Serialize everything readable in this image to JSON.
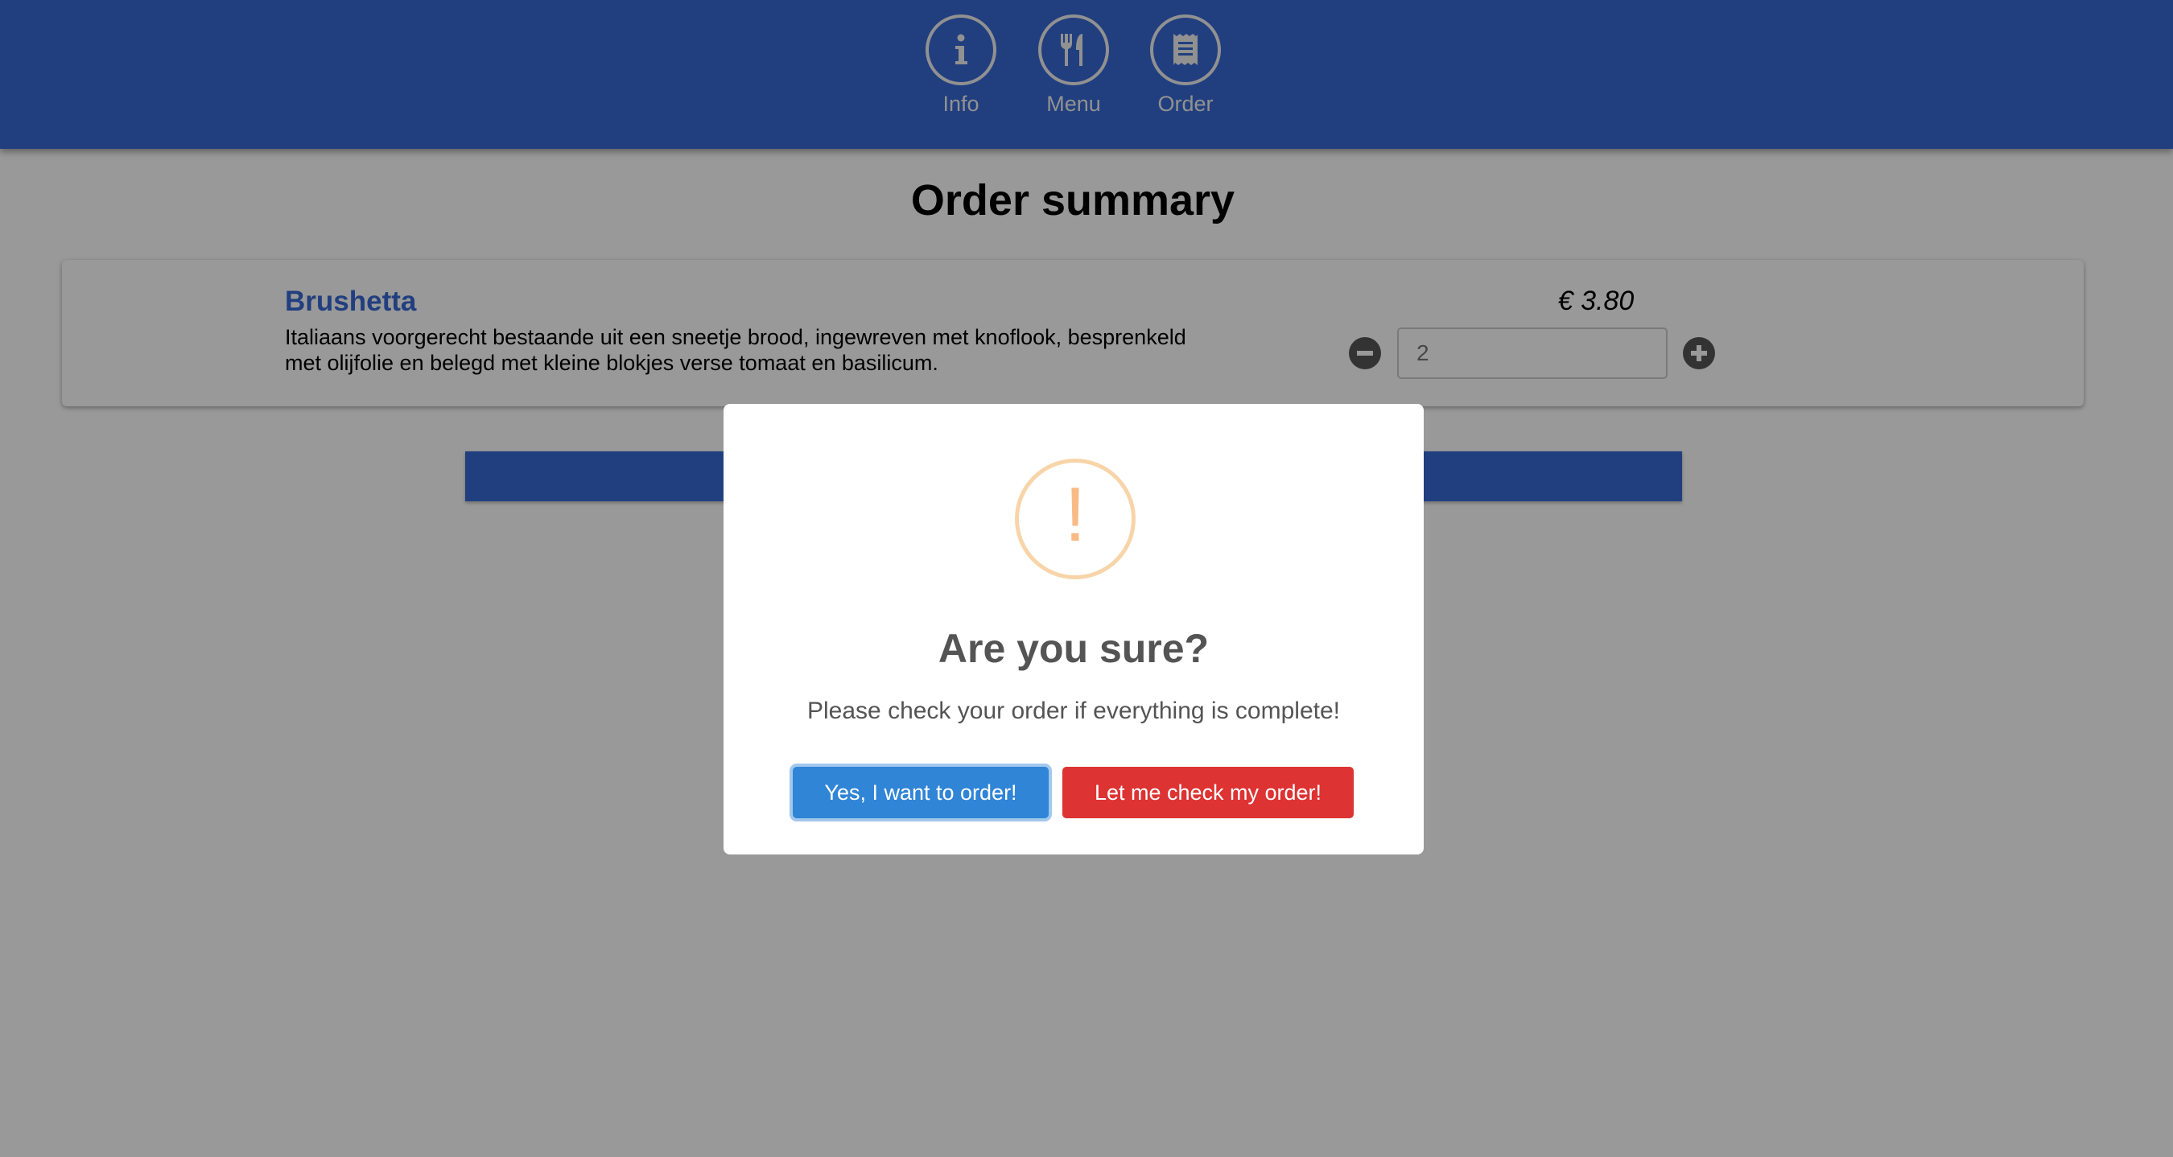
{
  "colors": {
    "nav_background": "#3869d4",
    "confirm_button": "#3085d6",
    "cancel_button": "#dd3333",
    "warning_icon": "#f8bb86"
  },
  "nav": {
    "items": [
      {
        "label": "Info",
        "icon": "info-icon"
      },
      {
        "label": "Menu",
        "icon": "fork-knife-icon"
      },
      {
        "label": "Order",
        "icon": "receipt-icon"
      }
    ]
  },
  "main": {
    "title": "Order summary",
    "items": [
      {
        "name": "Brushetta",
        "description": "Italiaans voorgerecht bestaande uit een sneetje brood, ingewreven met knoflook, besprenkeld met olijfolie en belegd met kleine blokjes verse tomaat en basilicum.",
        "price": "€ 3.80",
        "quantity": "2"
      }
    ]
  },
  "modal": {
    "icon": "warning-icon",
    "icon_glyph": "!",
    "title": "Are you sure?",
    "text": "Please check your order if everything is complete!",
    "confirm_label": "Yes, I want to order!",
    "cancel_label": "Let me check my order!"
  }
}
